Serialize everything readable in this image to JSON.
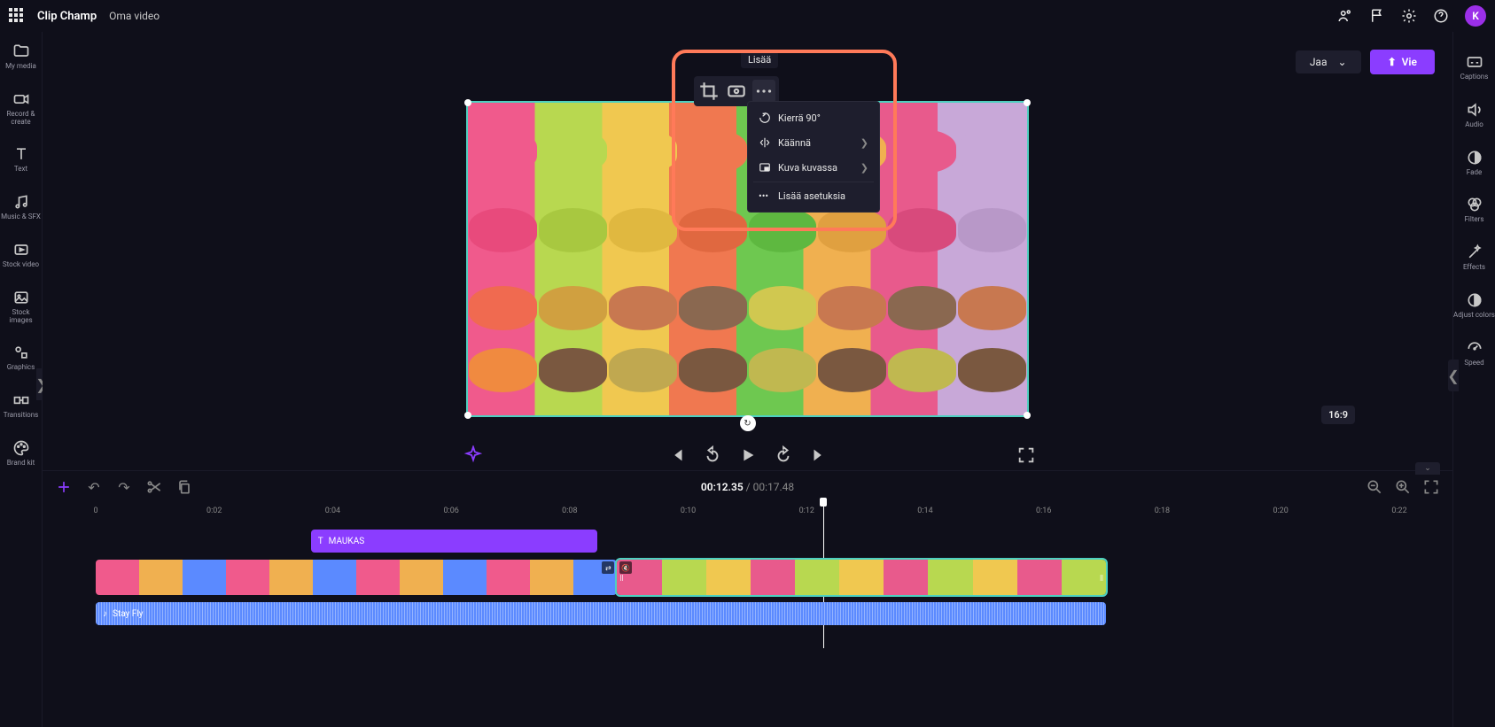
{
  "header": {
    "brand": "Clip Champ",
    "project_name": "Oma video",
    "avatar_initial": "K"
  },
  "left_sidebar": {
    "items": [
      {
        "label": "My media"
      },
      {
        "label": "Record & create"
      },
      {
        "label": "Text"
      },
      {
        "label": "Music & SFX"
      },
      {
        "label": "Stock video"
      },
      {
        "label": "Stock images"
      },
      {
        "label": "Graphics"
      },
      {
        "label": "Transitions"
      },
      {
        "label": "Brand kit"
      }
    ]
  },
  "top_controls": {
    "share_label": "Jaa",
    "export_label": "Vie"
  },
  "floating_toolbar": {
    "tooltip": "Lisää"
  },
  "context_menu": {
    "rotate": "Kierrä 90°",
    "flip": "Käännä",
    "pip": "Kuva kuvassa",
    "more": "Lisää asetuksia"
  },
  "preview": {
    "aspect": "16:9"
  },
  "timeline": {
    "current_time": "00:12.35",
    "duration": "00:17.48",
    "ruler": [
      "0",
      "0:02",
      "0:04",
      "0:06",
      "0:08",
      "0:10",
      "0:12",
      "0:14",
      "0:16",
      "0:18",
      "0:20",
      "0:22"
    ],
    "text_clip_label": "MAUKAS",
    "audio_clip_label": "Stay Fly"
  },
  "right_sidebar": {
    "items": [
      {
        "label": "Captions"
      },
      {
        "label": "Audio"
      },
      {
        "label": "Fade"
      },
      {
        "label": "Filters"
      },
      {
        "label": "Effects"
      },
      {
        "label": "Adjust colors"
      },
      {
        "label": "Speed"
      }
    ]
  }
}
